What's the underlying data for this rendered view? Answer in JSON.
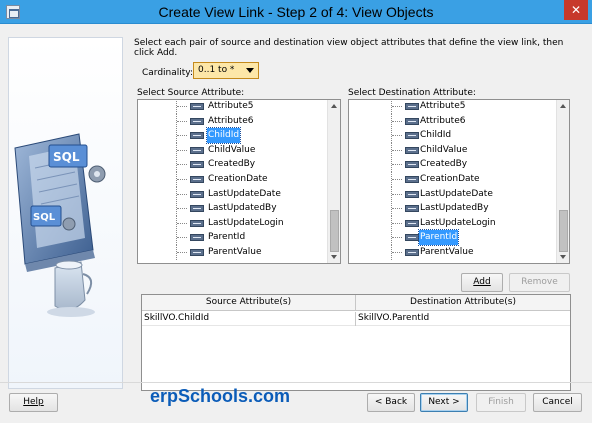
{
  "window": {
    "title": "Create View Link - Step 2 of 4: View Objects",
    "close_glyph": "✕"
  },
  "instructions": "Select each pair of source and destination view object attributes that define the view link, then click Add.",
  "cardinality": {
    "label": "Cardinality:",
    "value": "0..1 to *"
  },
  "source": {
    "label": "Select Source Attribute:",
    "items": [
      {
        "label": "Attribute5",
        "selected": false
      },
      {
        "label": "Attribute6",
        "selected": false
      },
      {
        "label": "ChildId",
        "selected": true
      },
      {
        "label": "ChildValue",
        "selected": false
      },
      {
        "label": "CreatedBy",
        "selected": false
      },
      {
        "label": "CreationDate",
        "selected": false
      },
      {
        "label": "LastUpdateDate",
        "selected": false
      },
      {
        "label": "LastUpdatedBy",
        "selected": false
      },
      {
        "label": "LastUpdateLogin",
        "selected": false
      },
      {
        "label": "ParentId",
        "selected": false
      },
      {
        "label": "ParentValue",
        "selected": false
      }
    ]
  },
  "destination": {
    "label": "Select Destination Attribute:",
    "items": [
      {
        "label": "Attribute5",
        "selected": false
      },
      {
        "label": "Attribute6",
        "selected": false
      },
      {
        "label": "ChildId",
        "selected": false
      },
      {
        "label": "ChildValue",
        "selected": false
      },
      {
        "label": "CreatedBy",
        "selected": false
      },
      {
        "label": "CreationDate",
        "selected": false
      },
      {
        "label": "LastUpdateDate",
        "selected": false
      },
      {
        "label": "LastUpdatedBy",
        "selected": false
      },
      {
        "label": "LastUpdateLogin",
        "selected": false
      },
      {
        "label": "ParentId",
        "selected": true
      },
      {
        "label": "ParentValue",
        "selected": false
      }
    ]
  },
  "buttons": {
    "add": "Add",
    "remove": "Remove",
    "help": "Help",
    "back": "< Back",
    "next": "Next >",
    "finish": "Finish",
    "cancel": "Cancel"
  },
  "mapping": {
    "headers": [
      "Source Attribute(s)",
      "Destination Attribute(s)"
    ],
    "rows": [
      [
        "SkillVO.ChildId",
        "SkillVO.ParentId"
      ]
    ]
  },
  "art": {
    "sql_label": "SQL"
  },
  "watermark": "erpSchools.com"
}
